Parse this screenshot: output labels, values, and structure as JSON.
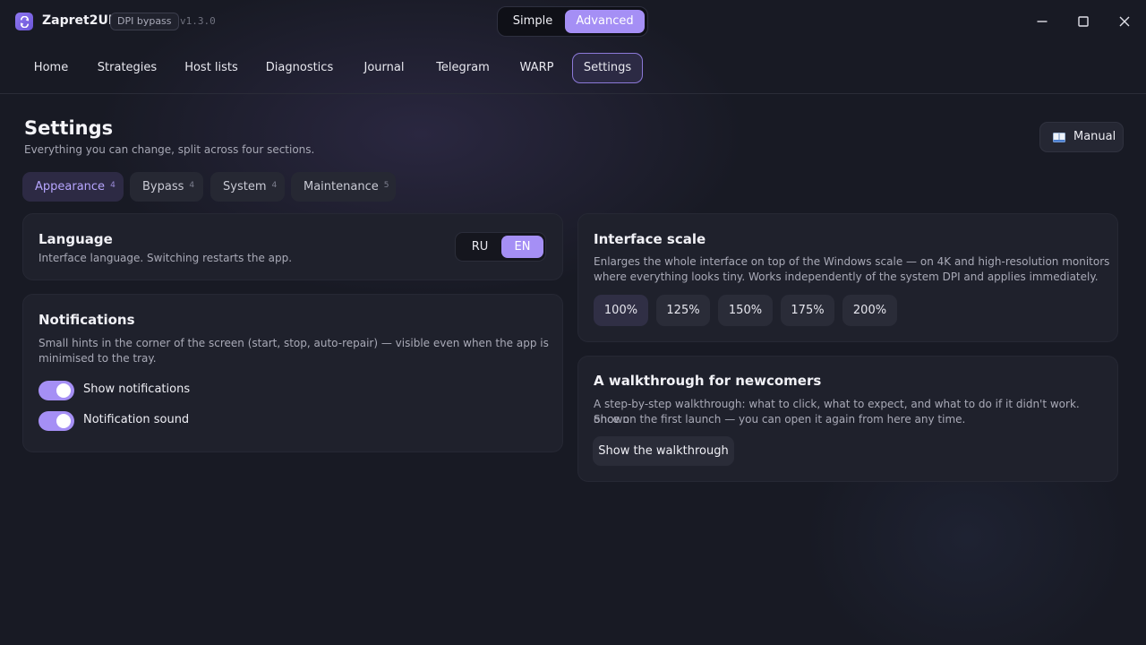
{
  "app": {
    "name": "Zapret2UI",
    "tag": "DPI bypass",
    "version": "v1.3.0"
  },
  "mode": {
    "options": [
      "Simple",
      "Advanced"
    ],
    "selected": "Advanced"
  },
  "nav": {
    "items": [
      "Home",
      "Strategies",
      "Host lists",
      "Diagnostics",
      "Journal",
      "Telegram",
      "WARP",
      "Settings"
    ],
    "active": "Settings"
  },
  "page": {
    "title": "Settings",
    "subtitle": "Everything you can change, split across four sections.",
    "manual_label": "Manual"
  },
  "tabs": [
    {
      "label": "Appearance",
      "count": "4"
    },
    {
      "label": "Bypass",
      "count": "4"
    },
    {
      "label": "System",
      "count": "4"
    },
    {
      "label": "Maintenance",
      "count": "5"
    }
  ],
  "active_tab": "Appearance",
  "language": {
    "title": "Language",
    "description": "Interface language. Switching restarts the app.",
    "options": [
      "RU",
      "EN"
    ],
    "selected": "EN"
  },
  "notifications": {
    "title": "Notifications",
    "description_1": "Small hints in the corner of the screen (start, stop, auto-repair) — visible even when the app is",
    "description_2": "minimised to the tray.",
    "toggles": [
      {
        "label": "Show notifications",
        "on": true
      },
      {
        "label": "Notification sound",
        "on": true
      }
    ]
  },
  "scale": {
    "title": "Interface scale",
    "description_1": "Enlarges the whole interface on top of the Windows scale — on 4K and high-resolution monitors",
    "description_2": "where everything looks tiny. Works independently of the system DPI and applies immediately.",
    "options": [
      "100%",
      "125%",
      "150%",
      "175%",
      "200%"
    ],
    "selected": "100%"
  },
  "walkthrough": {
    "title": "A walkthrough for newcomers",
    "description_1": "A step-by-step walkthrough: what to click, what to expect, and what to do if it didn't work. Shown",
    "description_2": "once on the first launch — you can open it again from here any time.",
    "button_label": "Show the walkthrough"
  },
  "colors": {
    "accent": "#a58ff5",
    "background": "#181a24",
    "card": "#1f212c"
  }
}
